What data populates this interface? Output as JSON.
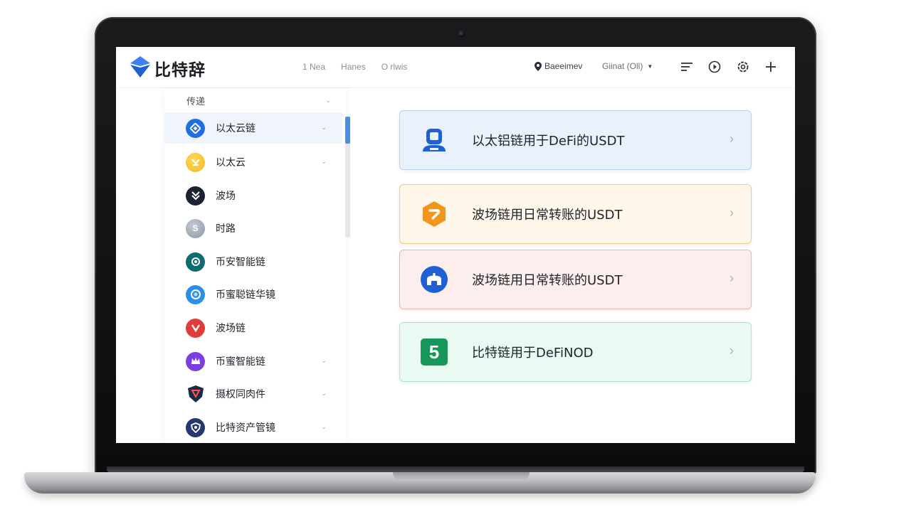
{
  "brand": {
    "name": "比特辞",
    "logo_icon": "diamond-logo-icon",
    "accent": "#1f6fe0"
  },
  "topbar": {
    "nav": [
      "1 Nea",
      "Hanes",
      "O rlwis"
    ],
    "location": "Baeeimev",
    "location_icon": "map-pin-icon",
    "language": "Giinat (Oll)",
    "icons": [
      "menu-icon",
      "play-circle-icon",
      "settings-icon",
      "plus-icon"
    ]
  },
  "sidebar": {
    "header": "传递",
    "items": [
      {
        "label": "以太云链",
        "icon": "ethereum-chain-icon",
        "color": "#1e6fe3",
        "chevron": true,
        "active": true
      },
      {
        "label": "以太云",
        "icon": "gold-coin-icon",
        "color": "#f2b81b",
        "chevron": true
      },
      {
        "label": "波场",
        "icon": "double-chevron-icon",
        "color": "#1c2230",
        "chevron": false
      },
      {
        "label": "时路",
        "icon": "grey-coin-icon",
        "color": "#8d96a3",
        "chevron": false
      },
      {
        "label": "币安智能链",
        "icon": "teal-node-icon",
        "color": "#0f6b6e",
        "chevron": false
      },
      {
        "label": "币蜜聪链华镜",
        "icon": "blue-ring-icon",
        "color": "#2a8fe8",
        "chevron": false
      },
      {
        "label": "波场链",
        "icon": "red-shield-icon",
        "color": "#e23b3b",
        "chevron": false
      },
      {
        "label": "币蜜智能链",
        "icon": "purple-crown-icon",
        "color": "#7a3fe0",
        "chevron": true
      },
      {
        "label": "摄权同肉件",
        "icon": "shield-badge-icon",
        "color": "#1b2a4a",
        "chevron": true
      },
      {
        "label": "比特资产管镜",
        "icon": "navy-shield-icon",
        "color": "#27386e",
        "chevron": true
      }
    ]
  },
  "cards": [
    {
      "text": "以太铝链用于DeFi的USDT",
      "icon": "user-terminal-icon",
      "bg": "#e9f1fd",
      "border": "#b9d1f3",
      "icon_color": "#1e5fd6"
    },
    {
      "text": "波场链用日常转账的USDT",
      "icon": "orange-hexagon-icon",
      "bg": "#fff7ea",
      "border": "#f3c98a",
      "icon_color": "#f2961b"
    },
    {
      "text": "波场链用日常转账的USDT",
      "icon": "blue-arch-icon",
      "bg": "#fdeeee",
      "border": "#efb2b2",
      "icon_color": "#1e5fd6"
    },
    {
      "text": "比特链用于DeFiNOD",
      "icon": "green-five-icon",
      "icon_text": "5",
      "bg": "#e9faf2",
      "border": "#a9e5c6",
      "icon_color": "#17965a"
    }
  ]
}
